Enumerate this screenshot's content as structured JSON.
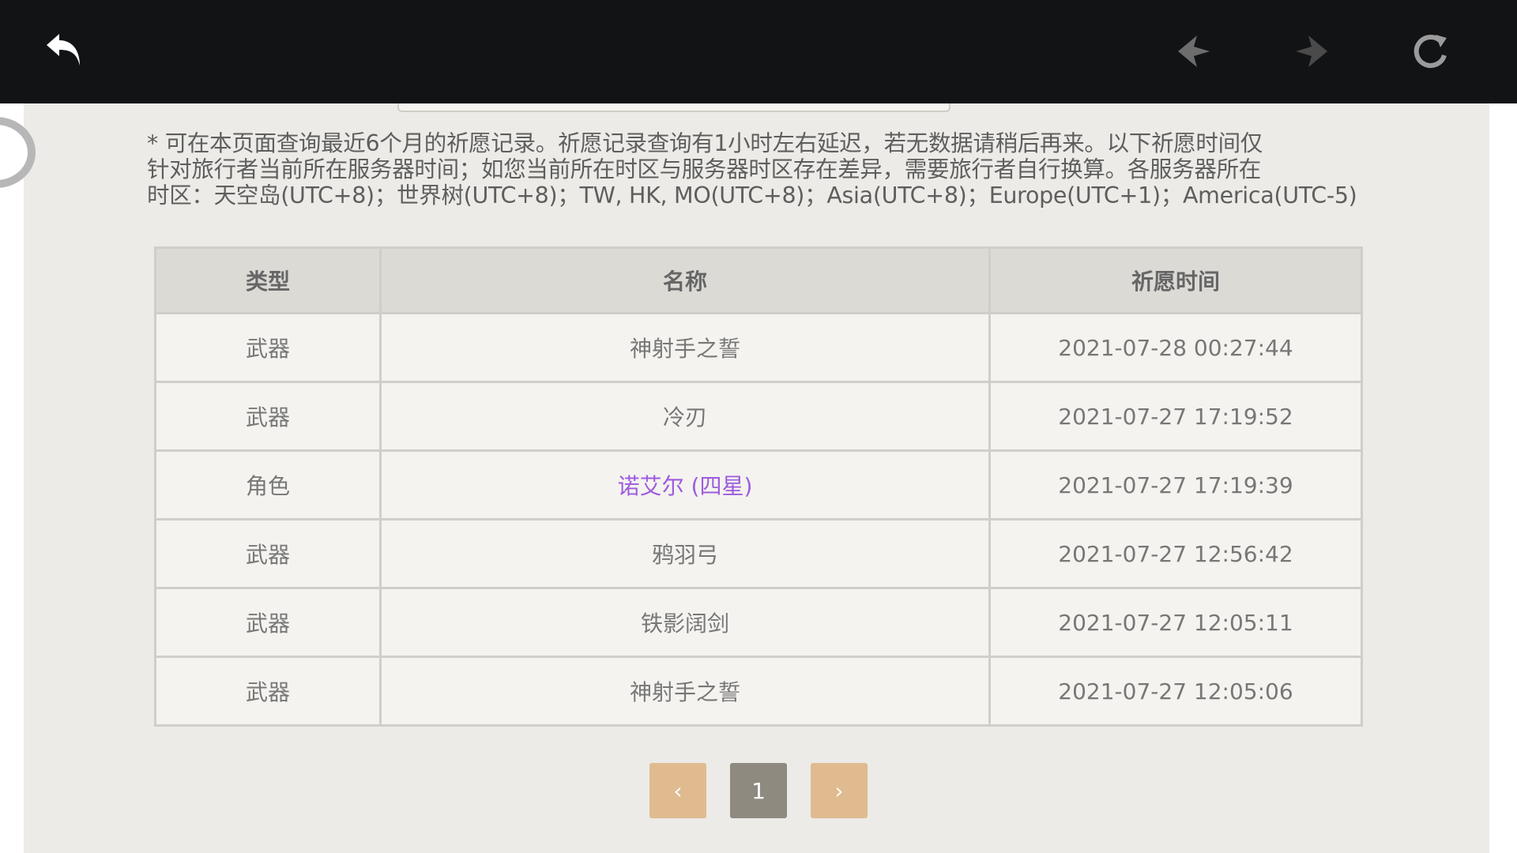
{
  "notice": {
    "line1": "* 可在本页面查询最近6个月的祈愿记录。祈愿记录查询有1小时左右延迟，若无数据请稍后再来。以下祈愿时间仅",
    "line2": "针对旅行者当前所在服务器时间；如您当前所在时区与服务器时区存在差异，需要旅行者自行换算。各服务器所在",
    "line3": "时区：天空岛(UTC+8)；世界树(UTC+8)；TW, HK, MO(UTC+8)；Asia(UTC+8)；Europe(UTC+1)；America(UTC-5)"
  },
  "table": {
    "headers": [
      "类型",
      "名称",
      "祈愿时间"
    ],
    "rows": [
      {
        "type": "武器",
        "name": "神射手之誓",
        "time": "2021-07-28 00:27:44"
      },
      {
        "type": "武器",
        "name": "冷刃",
        "time": "2021-07-27 17:19:52"
      },
      {
        "type": "角色",
        "name": "诺艾尔 (四星)",
        "time": "2021-07-27 17:19:39"
      },
      {
        "type": "武器",
        "name": "鸦羽弓",
        "time": "2021-07-27 12:56:42"
      },
      {
        "type": "武器",
        "name": "铁影阔剑",
        "time": "2021-07-27 12:05:11"
      },
      {
        "type": "武器",
        "name": "神射手之誓",
        "time": "2021-07-27 12:05:06"
      }
    ]
  },
  "pagination": {
    "prev": "‹",
    "current": "1",
    "next": "›"
  },
  "icons": {
    "back": "back-arrow-icon",
    "prev_nav": "nav-back-icon",
    "next_nav": "nav-forward-icon",
    "refresh": "refresh-icon"
  },
  "colors": {
    "four_star": "#9d5be0",
    "pager_button": "#dfbb8f",
    "pager_current": "#8e8a80"
  }
}
